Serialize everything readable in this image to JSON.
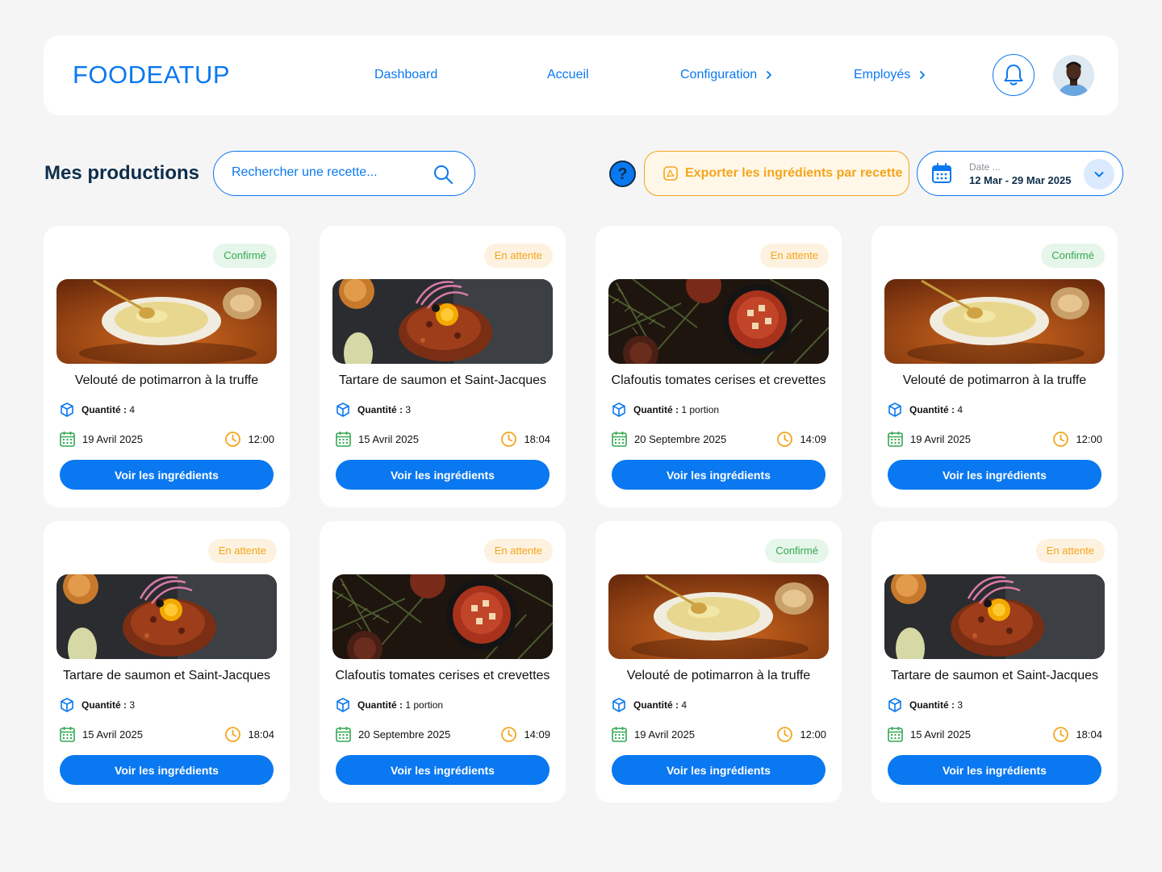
{
  "brand": {
    "logo": "FOODEATUP",
    "accent": "#0a78f0",
    "warning": "#f4a51c",
    "success": "#34a853"
  },
  "nav": [
    {
      "label": "Dashboard",
      "has_chevron": false
    },
    {
      "label": "Accueil",
      "has_chevron": false
    },
    {
      "label": "Configuration",
      "has_chevron": true
    },
    {
      "label": "Employés",
      "has_chevron": true
    }
  ],
  "header": {
    "bell_icon": "bell-icon",
    "avatar": "user-avatar"
  },
  "toolbar": {
    "title": "Mes productions",
    "search_placeholder": "Rechercher une recette...",
    "search_icon": "search-icon",
    "help_label": "?",
    "export_label": "Exporter les ingrédients par recette",
    "export_icon": "pdf-icon",
    "date_label": "Date ...",
    "date_range": "12 Mar - 29 Mar 2025",
    "date_icon": "calendar-icon"
  },
  "cards": [
    {
      "status": "Confirmé",
      "status_type": "ok",
      "photo": "veloute",
      "title": "Velouté de potimarron à la truffe",
      "qty_label": "Quantité :",
      "qty": "4",
      "date": "19 Avril 2025",
      "time": "12:00",
      "cta": "Voir les ingrédients"
    },
    {
      "status": "En attente",
      "status_type": "wait",
      "photo": "tartare",
      "title": "Tartare de saumon et Saint-Jacques",
      "qty_label": "Quantité :",
      "qty": "3",
      "date": "15 Avril 2025",
      "time": "18:04",
      "cta": "Voir les ingrédients"
    },
    {
      "status": "En attente",
      "status_type": "wait",
      "photo": "clafoutis",
      "title": "Clafoutis tomates cerises et crevettes",
      "qty_label": "Quantité :",
      "qty": "1 portion",
      "date": "20 Septembre 2025",
      "time": "14:09",
      "cta": "Voir les ingrédients"
    },
    {
      "status": "Confirmé",
      "status_type": "ok",
      "photo": "veloute",
      "title": "Velouté de potimarron à la truffe",
      "qty_label": "Quantité :",
      "qty": "4",
      "date": "19 Avril 2025",
      "time": "12:00",
      "cta": "Voir les ingrédients"
    },
    {
      "status": "En attente",
      "status_type": "wait",
      "photo": "tartare",
      "title": "Tartare de saumon et Saint-Jacques",
      "qty_label": "Quantité :",
      "qty": "3",
      "date": "15 Avril 2025",
      "time": "18:04",
      "cta": "Voir les ingrédients"
    },
    {
      "status": "En attente",
      "status_type": "wait",
      "photo": "clafoutis",
      "title": "Clafoutis tomates cerises et crevettes",
      "qty_label": "Quantité :",
      "qty": "1 portion",
      "date": "20 Septembre 2025",
      "time": "14:09",
      "cta": "Voir les ingrédients"
    },
    {
      "status": "Confirmé",
      "status_type": "ok",
      "photo": "veloute",
      "title": "Velouté de potimarron à la truffe",
      "qty_label": "Quantité :",
      "qty": "4",
      "date": "19 Avril 2025",
      "time": "12:00",
      "cta": "Voir les ingrédients"
    },
    {
      "status": "En attente",
      "status_type": "wait",
      "photo": "tartare",
      "title": "Tartare de saumon et Saint-Jacques",
      "qty_label": "Quantité :",
      "qty": "3",
      "date": "15 Avril 2025",
      "time": "18:04",
      "cta": "Voir les ingrédients"
    }
  ]
}
